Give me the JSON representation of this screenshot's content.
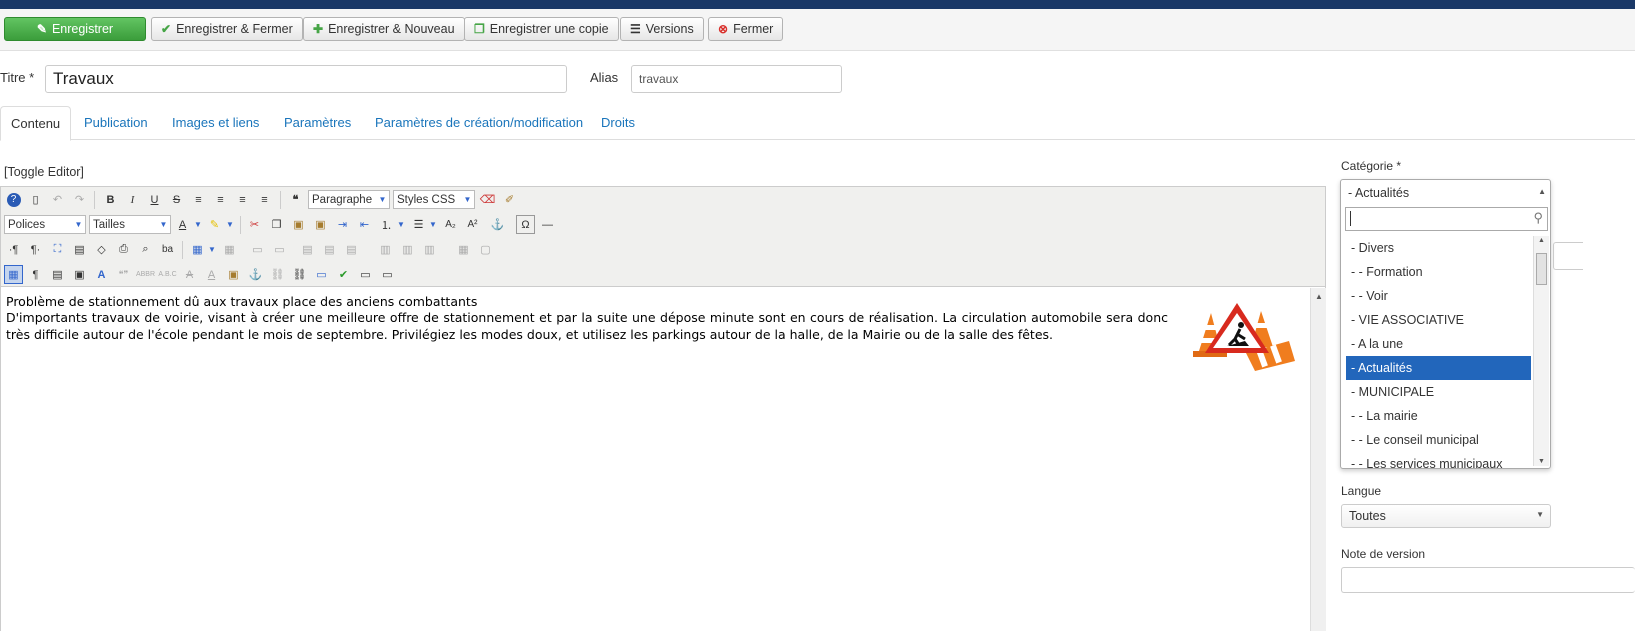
{
  "toolbar": {
    "save": "Enregistrer",
    "save_close": "Enregistrer & Fermer",
    "save_new": "Enregistrer & Nouveau",
    "save_copy": "Enregistrer une copie",
    "versions": "Versions",
    "close": "Fermer"
  },
  "form": {
    "title_label": "Titre *",
    "title_value": "Travaux",
    "alias_label": "Alias",
    "alias_value": "travaux"
  },
  "tabs": [
    "Contenu",
    "Publication",
    "Images et liens",
    "Paramètres",
    "Paramètres de création/modification",
    "Droits"
  ],
  "editor": {
    "toggle": "[Toggle Editor]",
    "format_select": "Paragraphe",
    "styles_select": "Styles CSS",
    "fonts_select": "Polices",
    "sizes_select": "Tailles",
    "line1": "Problème de stationnement dû aux travaux place des anciens combattants",
    "line2": "D'importants travaux de voirie, visant à créer une meilleure offre de stationnement et par la suite une dépose minute sont en cours de réalisation. La circulation automobile sera donc très difficile autour de l'école pendant le mois de septembre. Privilégiez les modes doux, et utilisez les parkings autour de la halle, de la Mairie ou de la salle des fêtes."
  },
  "sidebar": {
    "category_label": "Catégorie *",
    "category_selected": "- Actualités",
    "category_options": [
      "- Divers",
      "- - Formation",
      "- - Voir",
      "- VIE ASSOCIATIVE",
      "- A la une",
      "- Actualités",
      "- MUNICIPALE",
      "- - La mairie",
      "- - Le conseil municipal",
      "- - Les services municipaux"
    ],
    "language_label": "Langue",
    "language_value": "Toutes",
    "version_note_label": "Note de version"
  },
  "colors": {
    "primary": "#46a546",
    "link": "#1a75bb",
    "selected": "#2266bb",
    "header": "#1a3867"
  }
}
